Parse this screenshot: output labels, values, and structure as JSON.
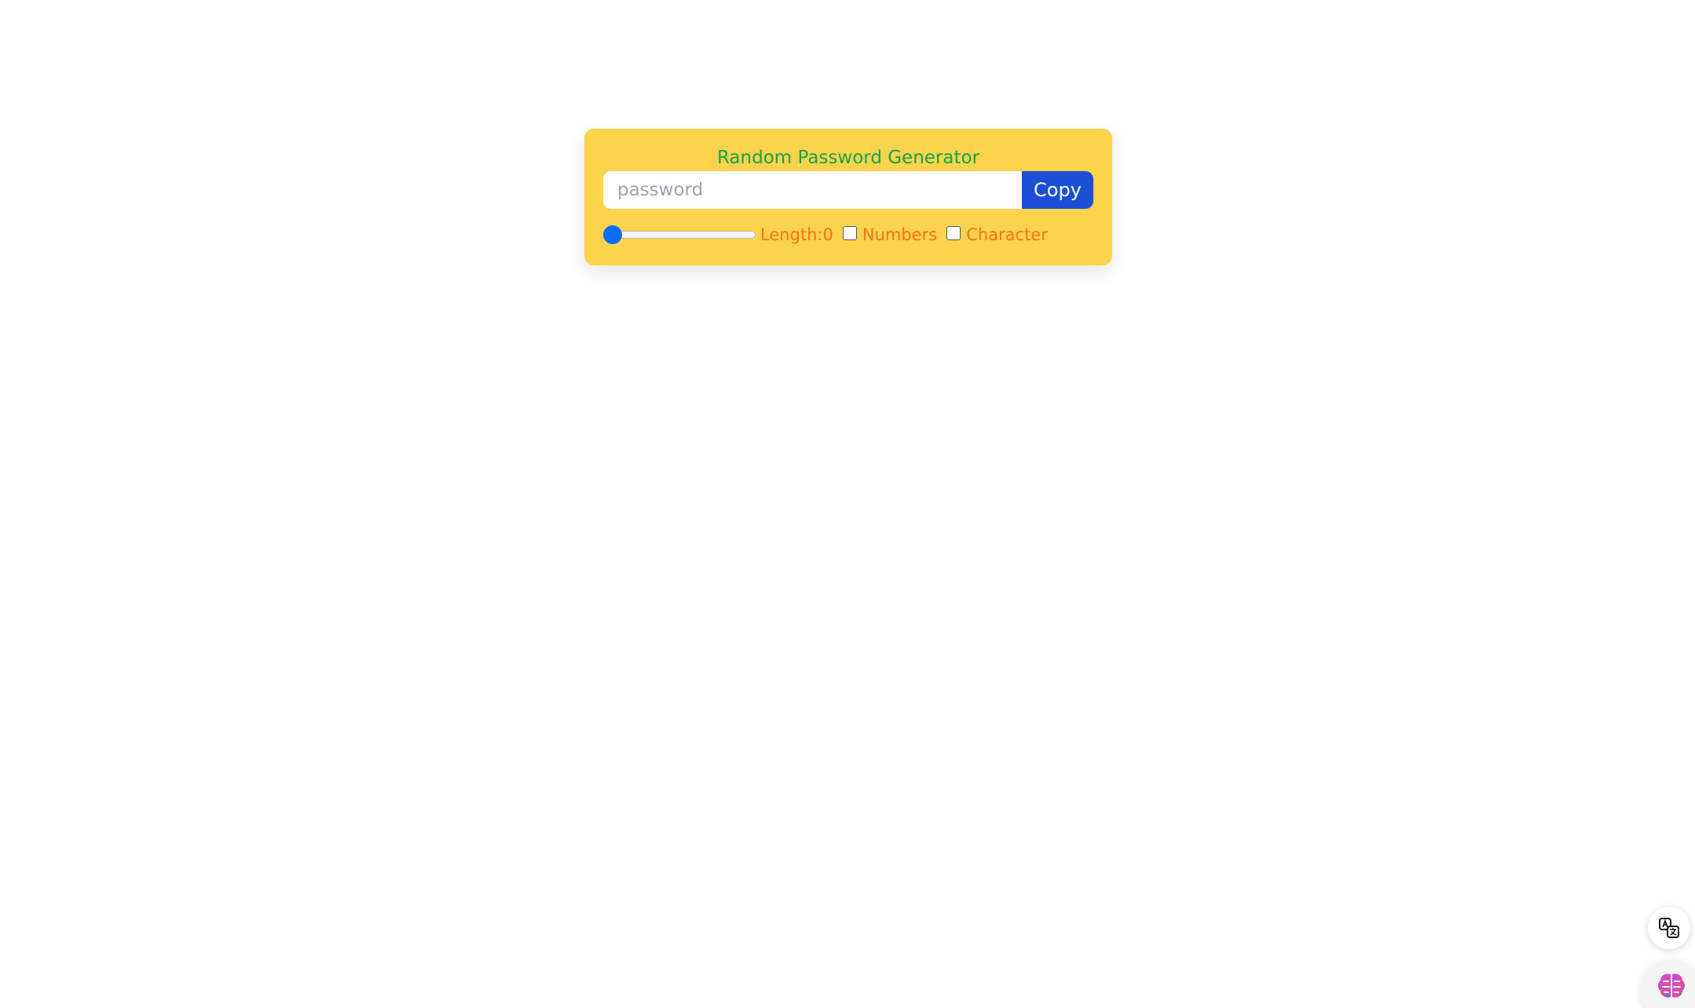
{
  "card": {
    "title": "Random Password Generator",
    "password_placeholder": "password",
    "password_value": "",
    "copy_label": "Copy",
    "length_label": "Length:0",
    "length_value": 0,
    "numbers_label": "Numbers",
    "numbers_checked": false,
    "character_label": "Character",
    "character_checked": false
  },
  "colors": {
    "card_bg": "#fcd34d",
    "title": "#16a34a",
    "labels": "#f97316",
    "copy_button": "#1d4ed8",
    "slider_thumb": "#0a6cff"
  },
  "floating_buttons": {
    "translate_icon": "translate-icon",
    "assistant_icon": "brain-icon"
  }
}
